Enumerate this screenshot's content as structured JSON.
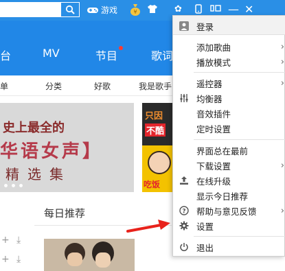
{
  "titlebar": {
    "search_icon": "search-icon",
    "items": [
      {
        "name": "game",
        "icon": "gamepad-icon",
        "label": "游戏"
      },
      {
        "name": "moneybag",
        "icon": "moneybag-icon",
        "label": ""
      },
      {
        "name": "skin",
        "icon": "tshirt-icon",
        "label": ""
      },
      {
        "name": "settings",
        "icon": "gear-icon",
        "label": ""
      },
      {
        "name": "mobile",
        "icon": "phone-icon",
        "label": ""
      },
      {
        "name": "minimode",
        "icon": "mini-mode-icon",
        "label": ""
      },
      {
        "name": "minimize",
        "icon": "minimize-icon",
        "label": ""
      },
      {
        "name": "close",
        "icon": "close-icon",
        "label": ""
      }
    ]
  },
  "nav": {
    "items": [
      "台",
      "MV",
      "节目",
      "歌词"
    ]
  },
  "subnav": {
    "items": [
      "歌单",
      "分类",
      "好歌",
      "我是歌手"
    ]
  },
  "banner": {
    "line1": "史上最全的",
    "line2": "华语女声】",
    "line3": "精选集"
  },
  "promo": {
    "t1": "只因",
    "t2": "不酷",
    "t3": "吃饭"
  },
  "daily": {
    "title": "每日推荐"
  },
  "menu": {
    "items": [
      {
        "label": "登录",
        "icon": "user-icon",
        "submenu": false
      },
      {
        "label": "添加歌曲",
        "icon": "",
        "submenu": true
      },
      {
        "label": "播放模式",
        "icon": "",
        "submenu": true
      },
      {
        "label": "遥控器",
        "icon": "",
        "submenu": true
      },
      {
        "label": "均衡器",
        "icon": "equalizer-icon",
        "submenu": false
      },
      {
        "label": "音效插件",
        "icon": "",
        "submenu": false
      },
      {
        "label": "定时设置",
        "icon": "",
        "submenu": false
      },
      {
        "label": "界面总在最前",
        "icon": "",
        "submenu": false
      },
      {
        "label": "下载设置",
        "icon": "",
        "submenu": true
      },
      {
        "label": "在线升级",
        "icon": "upgrade-icon",
        "submenu": false
      },
      {
        "label": "显示今日推荐",
        "icon": "",
        "submenu": false
      },
      {
        "label": "帮助与意见反馈",
        "icon": "help-icon",
        "submenu": true
      },
      {
        "label": "设置",
        "icon": "gear-icon",
        "submenu": false
      },
      {
        "label": "退出",
        "icon": "power-icon",
        "submenu": false
      }
    ]
  },
  "colors": {
    "titlebar": "#2a8fe6",
    "navbar": "#2187e7",
    "annotation_arrow": "#e8221b"
  }
}
